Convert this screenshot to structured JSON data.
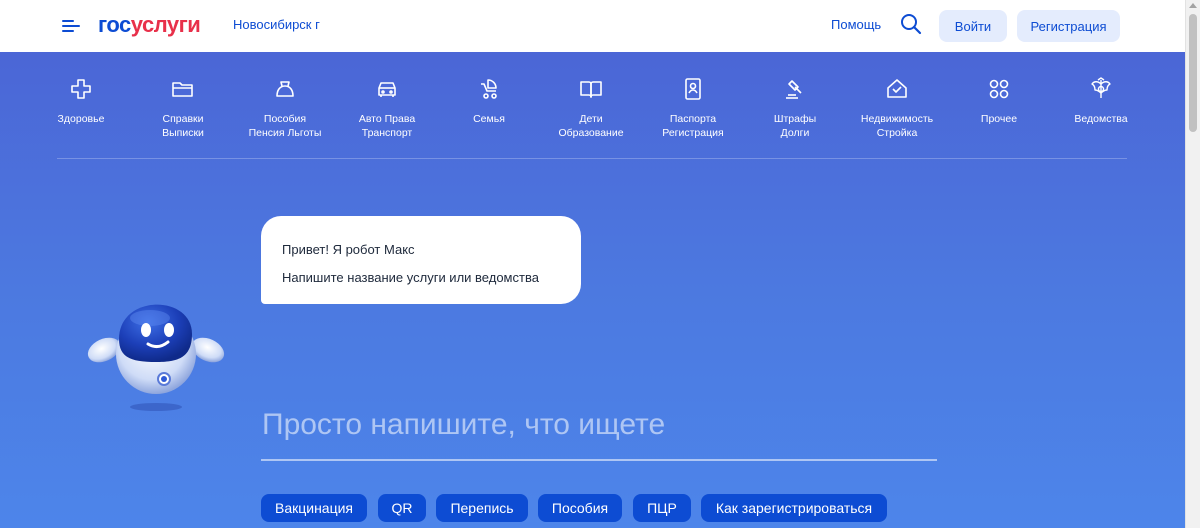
{
  "header": {
    "logo_part1": "гос",
    "logo_part2": "услуги",
    "city": "Новосибирск г",
    "help": "Помощь",
    "login": "Войти",
    "register": "Регистрация"
  },
  "categories": [
    {
      "label": "Здоровье",
      "icon": "plus-cross-icon"
    },
    {
      "label": "Справки\nВыписки",
      "icon": "folder-icon"
    },
    {
      "label": "Пособия\nПенсия Льготы",
      "icon": "wallet-bag-icon"
    },
    {
      "label": "Авто Права\nТранспорт",
      "icon": "car-icon"
    },
    {
      "label": "Семья",
      "icon": "stroller-icon"
    },
    {
      "label": "Дети\nОбразование",
      "icon": "book-icon"
    },
    {
      "label": "Паспорта\nРегистрация",
      "icon": "passport-icon"
    },
    {
      "label": "Штрафы\nДолги",
      "icon": "gavel-icon"
    },
    {
      "label": "Недвижимость\nСтройка",
      "icon": "house-icon"
    },
    {
      "label": "Прочее",
      "icon": "grid-icon"
    },
    {
      "label": "Ведомства",
      "icon": "coat-of-arms-icon"
    }
  ],
  "bubble": {
    "line1": "Привет! Я робот Макс",
    "line2": "Напишите название услуги или ведомства"
  },
  "search": {
    "placeholder": "Просто напишите, что ищете"
  },
  "chips": [
    "Вакцинация",
    "QR",
    "Перепись",
    "Пособия",
    "ПЦР",
    "Как зарегистрироваться"
  ],
  "colors": {
    "brand_blue": "#0d4cd3",
    "brand_red": "#e8304a",
    "hero_top": "#4b66d6",
    "hero_bottom": "#4d85ea",
    "button_bg": "#e4ecfd"
  }
}
